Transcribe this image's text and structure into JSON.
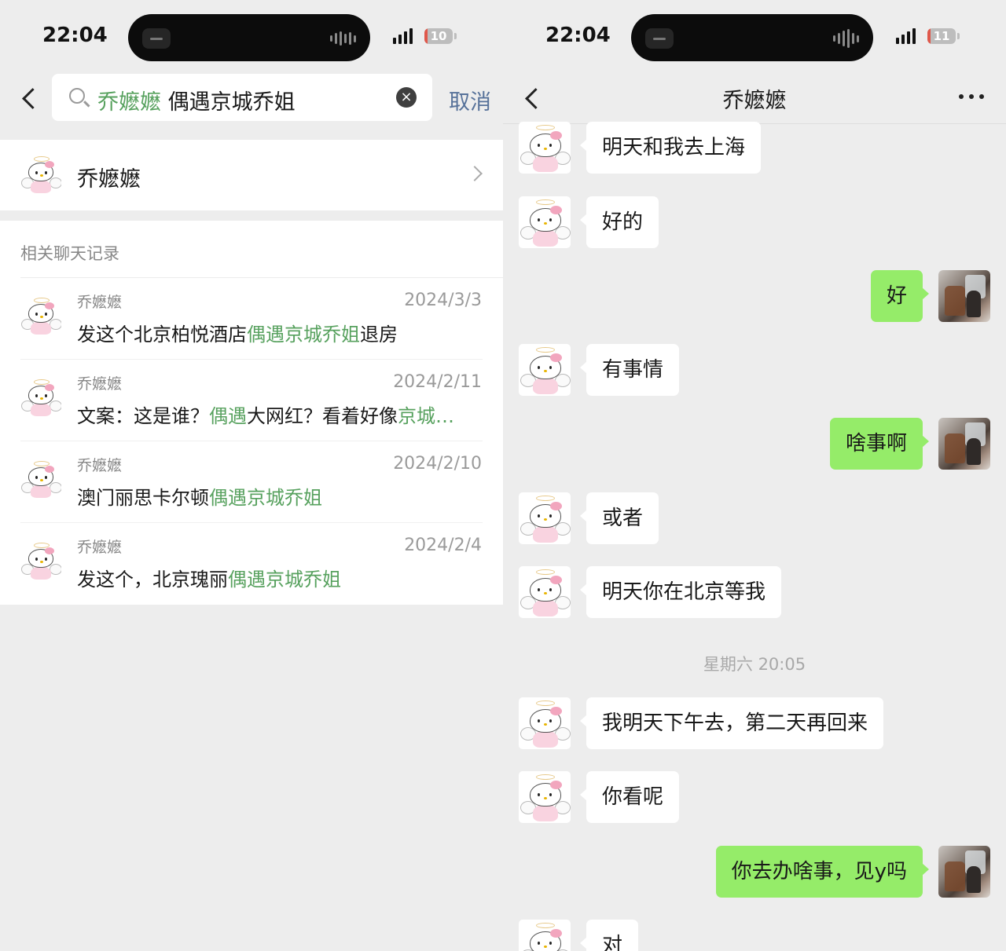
{
  "left": {
    "status": {
      "time": "22:04",
      "battery": "10",
      "battery_level": 0.1
    },
    "search": {
      "tag": "乔嬷嬷",
      "query": " 偶遇京城乔姐",
      "cancel_label": "取消"
    },
    "contact": {
      "name": "乔嬷嬷"
    },
    "records_title": "相关聊天记录",
    "records": [
      {
        "name": "乔嬷嬷",
        "date": "2024/3/3",
        "parts": [
          "发这个北京柏悦酒店",
          "偶遇京城乔姐",
          "退房"
        ]
      },
      {
        "name": "乔嬷嬷",
        "date": "2024/2/11",
        "parts": [
          "文案：这是谁？",
          "偶遇",
          "大网红？看着好像",
          "京城…",
          ""
        ]
      },
      {
        "name": "乔嬷嬷",
        "date": "2024/2/10",
        "parts": [
          "澳门丽思卡尔顿",
          "偶遇京城乔姐",
          ""
        ]
      },
      {
        "name": "乔嬷嬷",
        "date": "2024/2/4",
        "parts": [
          "发这个，北京瑰丽",
          "偶遇京城乔姐",
          ""
        ]
      }
    ]
  },
  "right": {
    "status": {
      "time": "22:04",
      "battery": "11",
      "battery_level": 0.11
    },
    "title": "乔嬷嬷",
    "messages": [
      {
        "from": "them",
        "text": "明天和我去上海"
      },
      {
        "from": "them",
        "text": "好的"
      },
      {
        "from": "me",
        "text": "好"
      },
      {
        "from": "them",
        "text": "有事情"
      },
      {
        "from": "me",
        "text": "啥事啊"
      },
      {
        "from": "them",
        "text": "或者"
      },
      {
        "from": "them",
        "text": "明天你在北京等我"
      },
      {
        "from": "them",
        "text": "我明天下午去，第二天再回来"
      },
      {
        "from": "them",
        "text": "你看呢"
      },
      {
        "from": "me",
        "text": "你去办啥事，见y吗"
      },
      {
        "from": "them",
        "text": "对"
      }
    ],
    "timestamp": "星期六 20:05"
  },
  "colors": {
    "highlight": "#57a15e",
    "my_bubble": "#95ec69",
    "background": "#ededed",
    "cancel_link": "#57729a"
  }
}
